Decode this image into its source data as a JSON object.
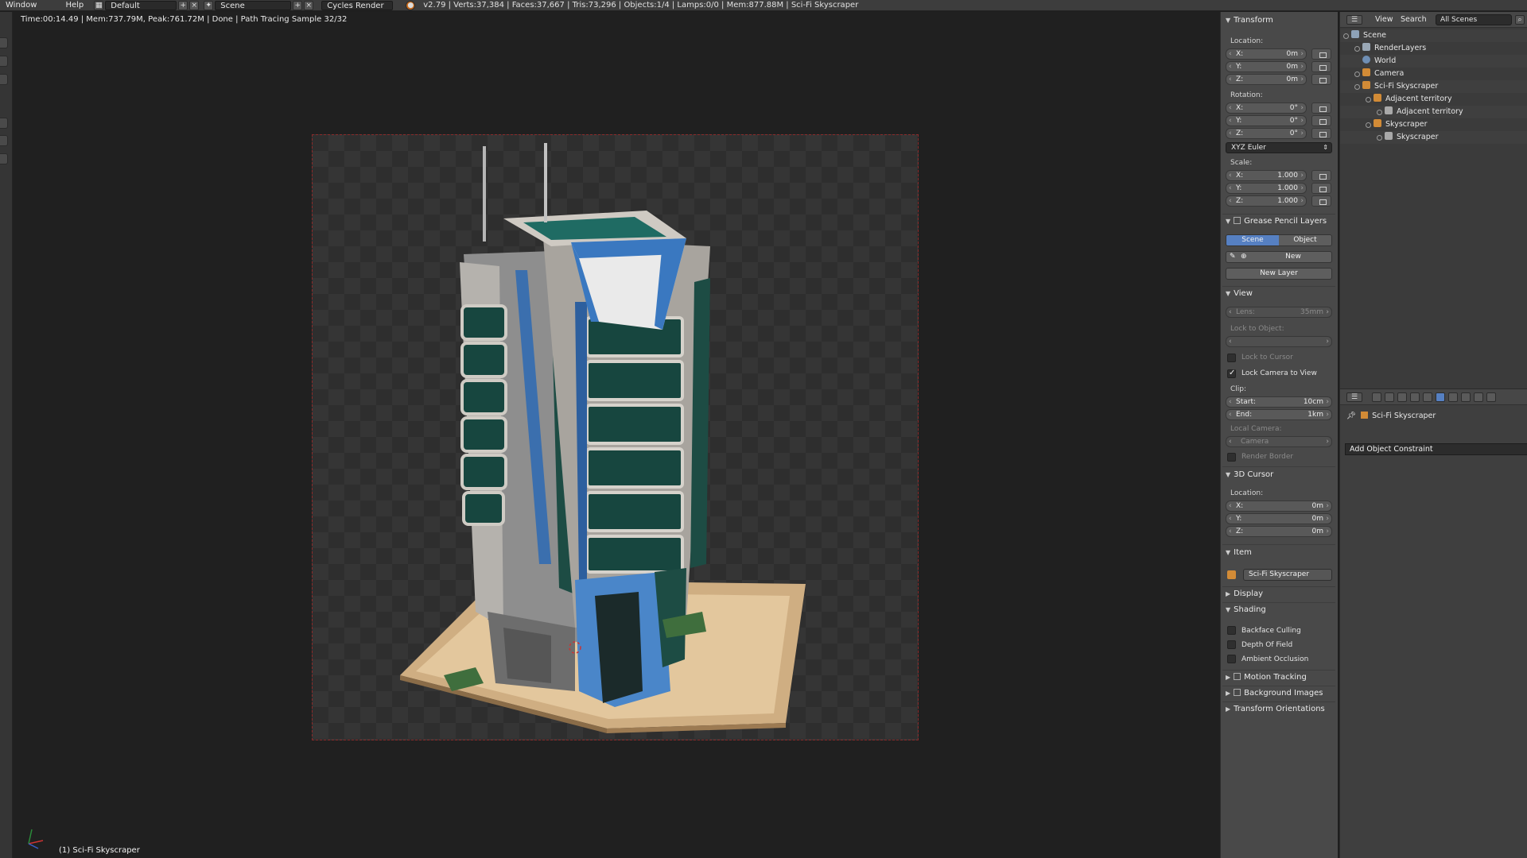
{
  "topbar": {
    "menus": [
      "Window",
      "Help"
    ],
    "layout_name": "Default",
    "scene_name": "Scene",
    "engine": "Cycles Render",
    "stats": "v2.79 | Verts:37,384 | Faces:37,667 | Tris:73,296 | Objects:1/4 | Lamps:0/0 | Mem:877.88M | Sci-Fi Skyscraper"
  },
  "viewport": {
    "render_info": "Time:00:14.49 | Mem:737.79M, Peak:761.72M | Done | Path Tracing Sample 32/32",
    "object_label": "(1) Sci-Fi Skyscraper"
  },
  "properties": {
    "transform": {
      "title": "Transform",
      "location_label": "Location:",
      "location": [
        {
          "axis": "X:",
          "value": "0m"
        },
        {
          "axis": "Y:",
          "value": "0m"
        },
        {
          "axis": "Z:",
          "value": "0m"
        }
      ],
      "rotation_label": "Rotation:",
      "rotation": [
        {
          "axis": "X:",
          "value": "0°"
        },
        {
          "axis": "Y:",
          "value": "0°"
        },
        {
          "axis": "Z:",
          "value": "0°"
        }
      ],
      "rotation_mode": "XYZ Euler",
      "scale_label": "Scale:",
      "scale": [
        {
          "axis": "X:",
          "value": "1.000"
        },
        {
          "axis": "Y:",
          "value": "1.000"
        },
        {
          "axis": "Z:",
          "value": "1.000"
        }
      ]
    },
    "grease_pencil": {
      "title": "Grease Pencil Layers",
      "tab_scene": "Scene",
      "tab_object": "Object",
      "new_label": "New",
      "new_layer_label": "New Layer"
    },
    "view": {
      "title": "View",
      "lens_label": "Lens:",
      "lens_value": "35mm",
      "lock_to_object_label": "Lock to Object:",
      "lock_to_cursor_label": "Lock to Cursor",
      "lock_camera_label": "Lock Camera to View",
      "clip_label": "Clip:",
      "clip_start_label": "Start:",
      "clip_start_value": "10cm",
      "clip_end_label": "End:",
      "clip_end_value": "1km",
      "local_camera_label": "Local Camera:",
      "local_camera_value": "Camera",
      "render_border_label": "Render Border"
    },
    "cursor": {
      "title": "3D Cursor",
      "location_label": "Location:",
      "location": [
        {
          "axis": "X:",
          "value": "0m"
        },
        {
          "axis": "Y:",
          "value": "0m"
        },
        {
          "axis": "Z:",
          "value": "0m"
        }
      ]
    },
    "item": {
      "title": "Item",
      "name": "Sci-Fi Skyscraper"
    },
    "display_title": "Display",
    "shading": {
      "title": "Shading",
      "backface": "Backface Culling",
      "dof": "Depth Of Field",
      "ao": "Ambient Occlusion"
    },
    "motion_tracking": "Motion Tracking",
    "background_images": "Background Images",
    "transform_orientations": "Transform Orientations"
  },
  "outliner": {
    "menu_view": "View",
    "menu_search": "Search",
    "filter": "All Scenes",
    "items": [
      "Scene",
      "RenderLayers",
      "World",
      "Camera",
      "Sci-Fi Skyscraper",
      "Adjacent territory",
      "Adjacent territory",
      "Skyscraper",
      "Skyscraper"
    ]
  },
  "property_editor": {
    "breadcrumb": "Sci-Fi Skyscraper",
    "add_constraint": "Add Object Constraint"
  },
  "colors": {
    "accent": "#5680c2",
    "object_orange": "#d28b36",
    "camera_border": "#8a2a2a"
  }
}
